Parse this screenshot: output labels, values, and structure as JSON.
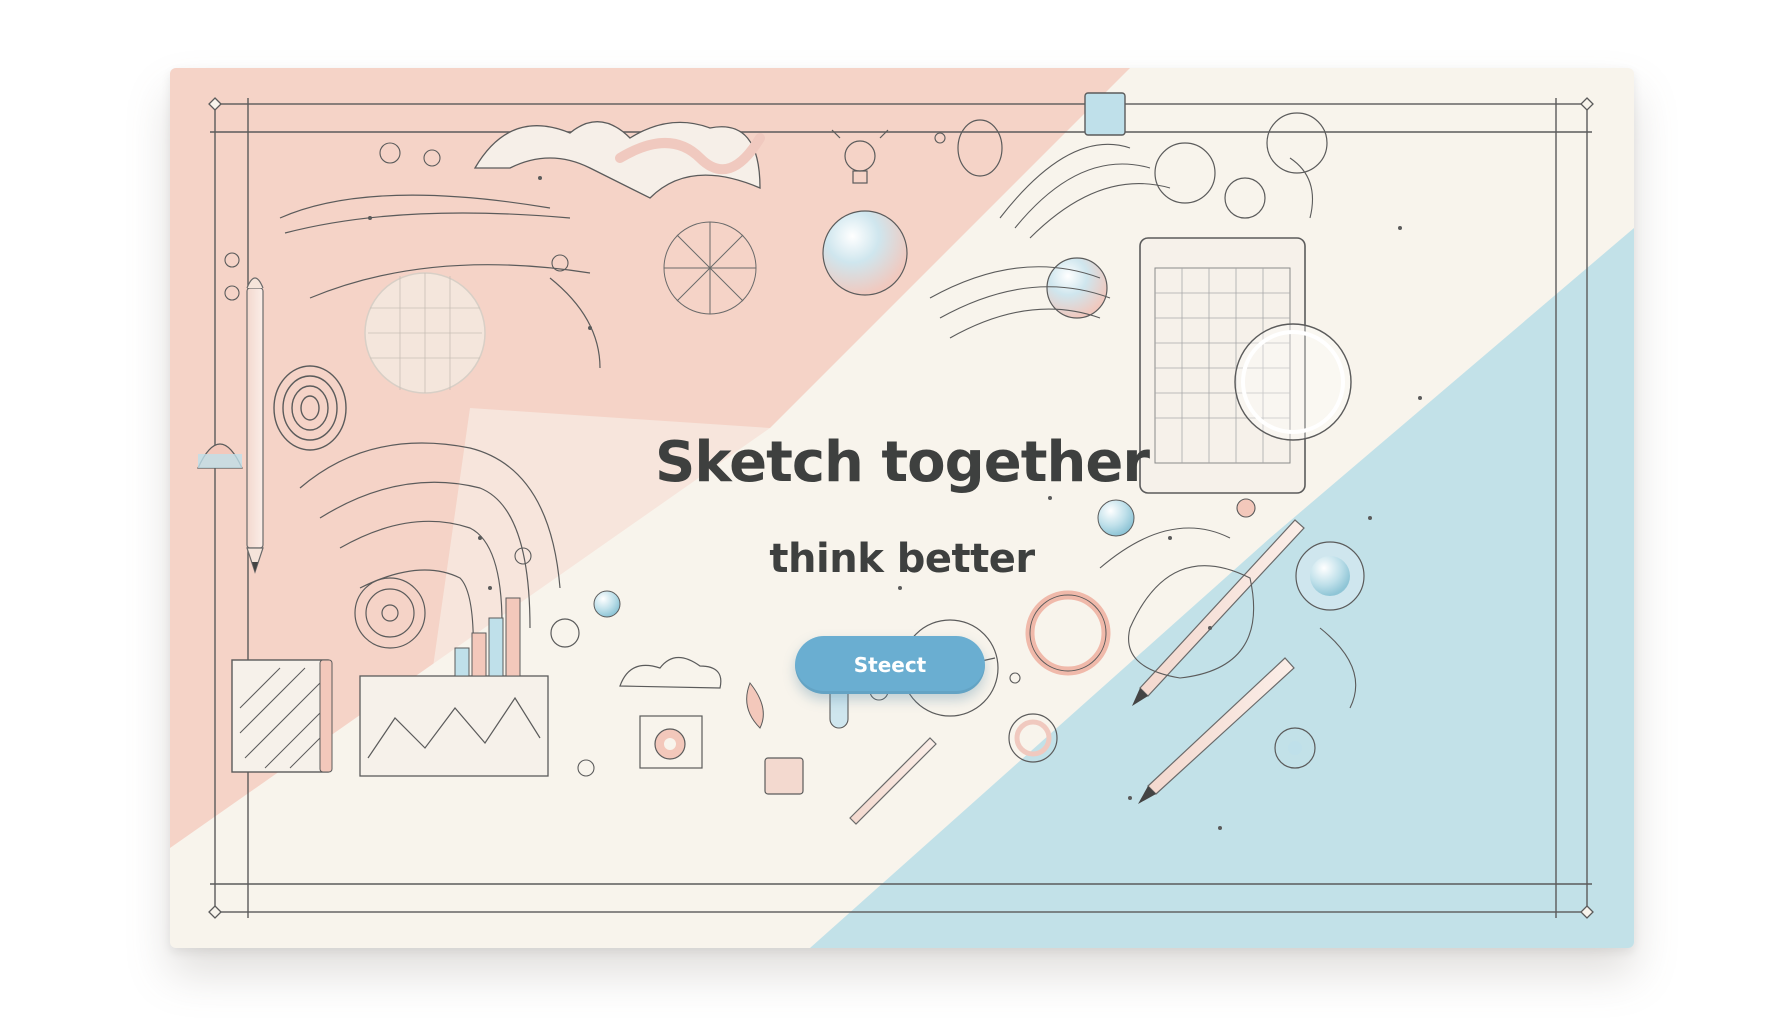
{
  "hero": {
    "headline": "Sketch together",
    "subheadline": "think better",
    "cta_label": "Steect"
  },
  "colors": {
    "page_background": "#ffffff",
    "card_cream": "#f8f4ec",
    "pastel_pink": "#f5cdc1",
    "pastel_blue": "#b9dde7",
    "button_blue": "#6aaed1",
    "text_dark": "#3e403f",
    "line_gray": "#5b5b5b"
  },
  "decorations": [
    "pencil-icon",
    "stylus-icon",
    "sphere-icon",
    "magnifier-icon",
    "tablet-grid-icon",
    "lightbulb-icon",
    "bar-chart-icon",
    "line-chart-icon",
    "cloud-icon",
    "wave-icon",
    "spiral-icon",
    "ring-icon",
    "gear-icon",
    "hatched-notepad-icon"
  ]
}
